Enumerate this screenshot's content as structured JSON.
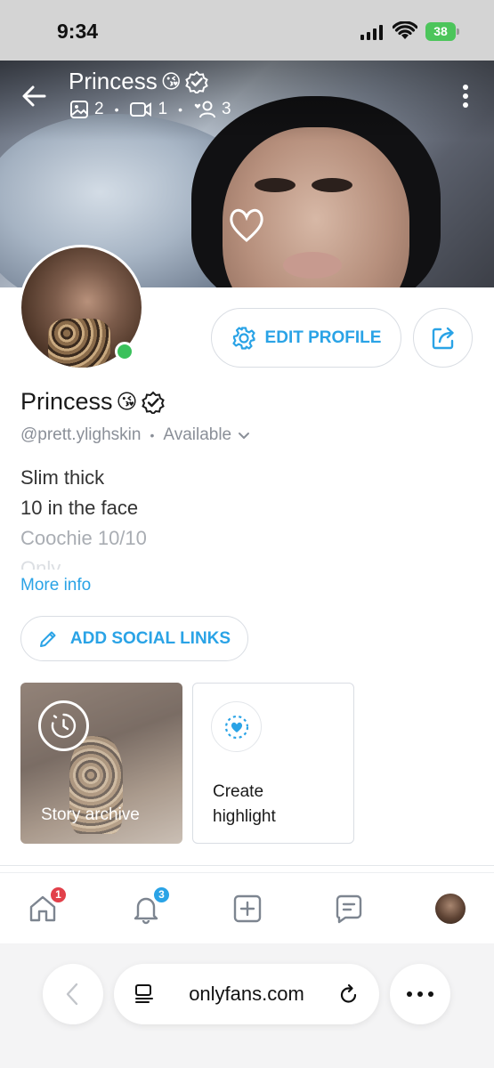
{
  "status_bar": {
    "time": "9:34",
    "battery": "38"
  },
  "header": {
    "name": "Princess",
    "emoji": "😘",
    "stats": {
      "photos": "2",
      "videos": "1",
      "fans": "3"
    }
  },
  "profile": {
    "edit_label": "EDIT PROFILE",
    "name": "Princess",
    "emoji": "😘",
    "handle": "@prett.ylighskin",
    "availability": "Available",
    "bio": [
      "Slim thick",
      "10 in the face",
      "Coochie 10/10",
      "Only"
    ],
    "more_info": "More info",
    "social_links_label": "ADD SOCIAL LINKS"
  },
  "highlights": {
    "story_archive_label": "Story archive",
    "create_highlight_line1": "Create",
    "create_highlight_line2": "highlight"
  },
  "bottom_nav": {
    "home_badge": "1",
    "notifications_badge": "3"
  },
  "browser": {
    "url": "onlyfans.com"
  },
  "colors": {
    "accent": "#2aa3e6",
    "online": "#3ac15b",
    "badge_red": "#e2404a"
  }
}
